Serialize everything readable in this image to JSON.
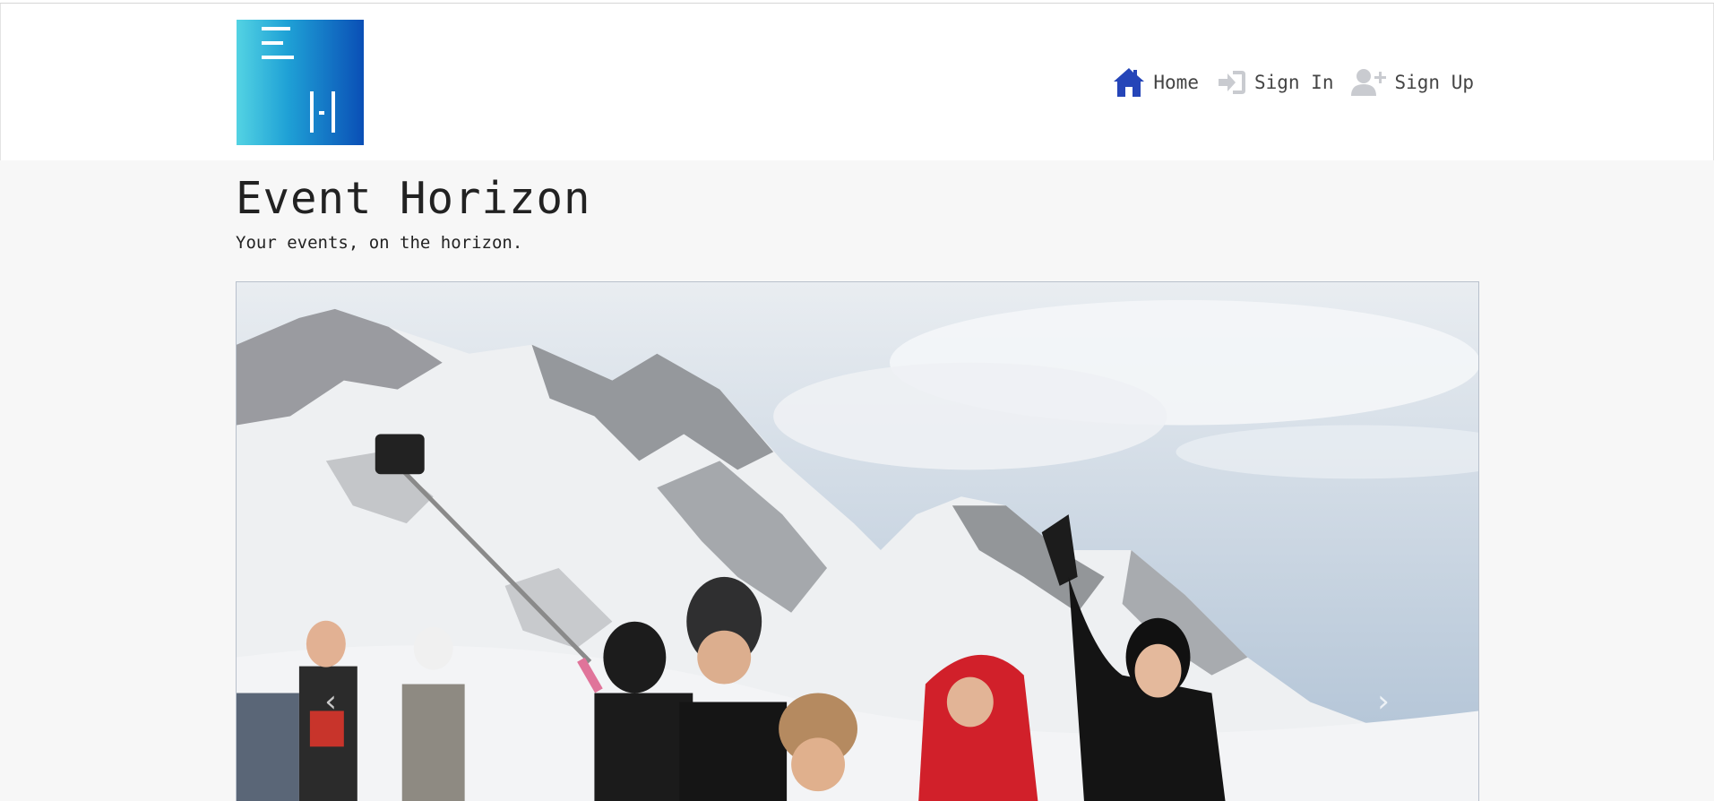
{
  "brand": {
    "logo_alt": "Event Horizon logo"
  },
  "nav": {
    "home_label": "Home",
    "sign_in_label": "Sign In",
    "sign_up_label": "Sign Up"
  },
  "hero": {
    "title": "Event Horizon",
    "tagline": "Your events, on the horizon."
  },
  "carousel": {
    "image_alt": "Group taking a selfie in front of snowy mountains",
    "prev_label": "‹",
    "next_label": "›"
  },
  "colors": {
    "home_icon": "#2545b8",
    "muted_icon": "#c9cbd0",
    "logo_start": "#53d3e3",
    "logo_end": "#0a4fb6"
  }
}
